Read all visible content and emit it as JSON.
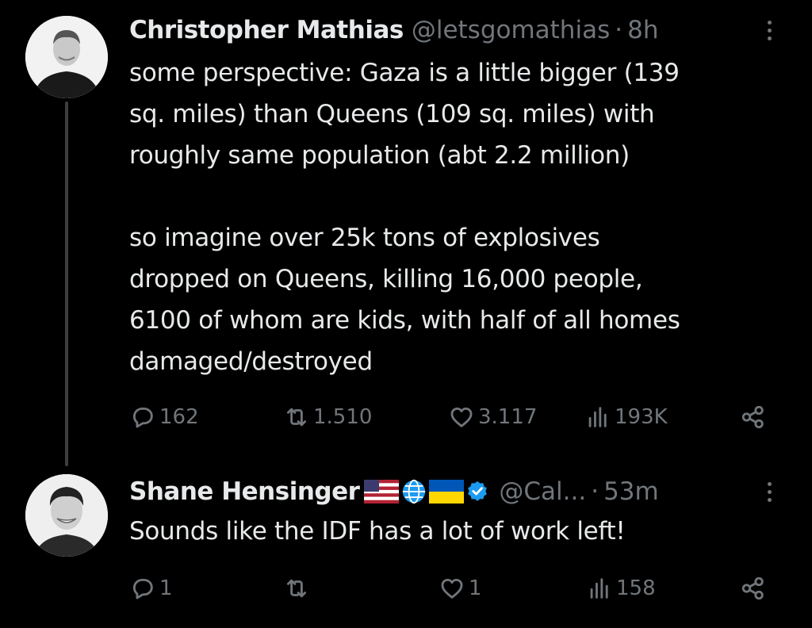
{
  "tweets": [
    {
      "author_name": "Christopher Mathias",
      "handle": "@letsgomathias",
      "separator": "·",
      "time": "8h",
      "text": "some perspective: Gaza is a little bigger (139\nsq. miles) than Queens (109 sq. miles) with\nroughly same population (abt 2.2 million)\n\nso imagine over 25k tons of explosives\ndropped on Queens, killing 16,000 people,\n6100 of whom are kids, with half of all homes\ndamaged/destroyed",
      "replies": "162",
      "retweets": "1.510",
      "likes": "3.117",
      "views": "193K"
    },
    {
      "author_name": "Shane Hensinger",
      "badge_icons": [
        "us-flag-icon",
        "globe-icon",
        "ukraine-flag-icon",
        "verified-badge-icon"
      ],
      "handle": "@Cal...",
      "separator": "·",
      "time": "53m",
      "text": "Sounds like the IDF has a lot of work left!",
      "replies": "1",
      "retweets": "",
      "likes": "1",
      "views": "158"
    }
  ],
  "colors": {
    "background": "#000000",
    "text": "#e7e9ea",
    "muted": "#71767b",
    "thread_line": "#3c3f42",
    "verified": "#1d9bf0"
  }
}
